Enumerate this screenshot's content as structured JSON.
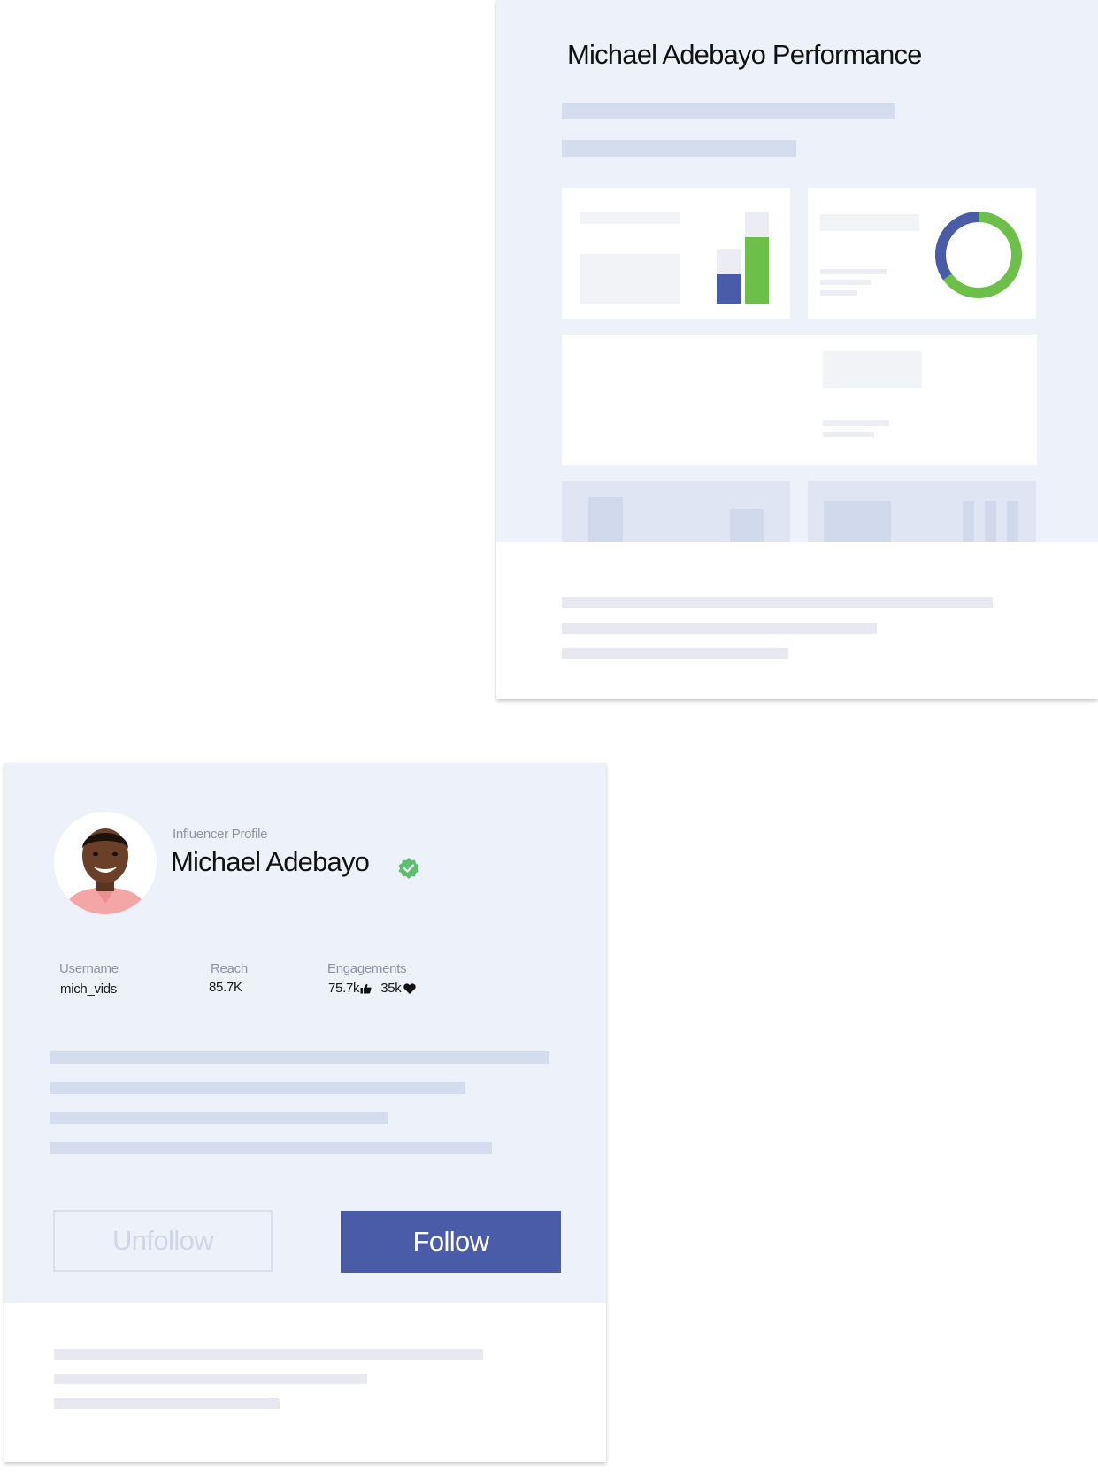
{
  "performance_card": {
    "title": "Michael Adebayo Performance",
    "colors": {
      "blue": "#4a5ba8",
      "green": "#6cc04a"
    }
  },
  "profile_card": {
    "label": "Influencer Profile",
    "name": "Michael Adebayo",
    "verified_icon": "verified-badge-icon",
    "stats": {
      "username": {
        "label": "Username",
        "value": "mich_vids"
      },
      "reach": {
        "label": "Reach",
        "value": "85.7K"
      },
      "engagements": {
        "label": "Engagements",
        "likes": "75.7k",
        "likes_icon": "thumbs-up-icon",
        "hearts": "35k",
        "hearts_icon": "heart-icon"
      }
    },
    "buttons": {
      "unfollow": "Unfollow",
      "follow": "Follow"
    }
  }
}
